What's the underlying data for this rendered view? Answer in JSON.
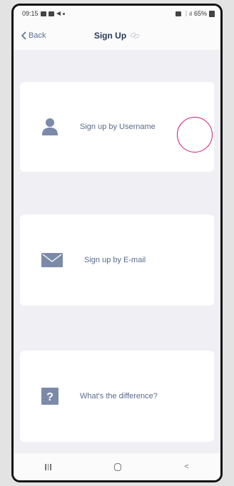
{
  "status_bar": {
    "time": "09:15",
    "battery": "65%"
  },
  "navbar": {
    "back_label": "Back",
    "title": "Sign Up"
  },
  "options": [
    {
      "label": "Sign up by Username",
      "icon": "person-icon"
    },
    {
      "label": "Sign up by E-mail",
      "icon": "envelope-icon"
    },
    {
      "label": "What's the difference?",
      "icon": "question-icon"
    }
  ],
  "colors": {
    "accent": "#5a6f96",
    "icon_fill": "#7b8aa8",
    "touch_indicator": "#d6197a",
    "card_bg": "#ffffff",
    "screen_bg": "#efeff4"
  },
  "android_nav": {
    "back_symbol": "<"
  }
}
